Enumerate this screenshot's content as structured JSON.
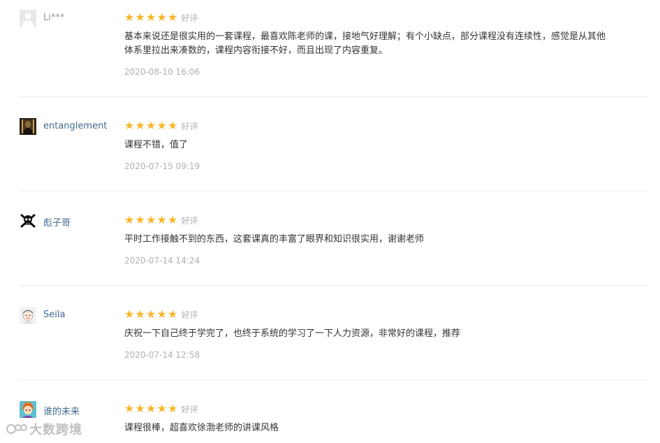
{
  "reviews": [
    {
      "username": "Li***",
      "avatar_icon": "default-user-icon",
      "rating": 5,
      "grade_label": "好评",
      "content_lines": [
        "基本来说还是很实用的一套课程，最喜欢陈老师的课，接地气好理解；有个小缺点，部分课程没有连续性，感觉是从其他",
        "体系里拉出来凑数的，课程内容衔接不好，而且出现了内容重复。"
      ],
      "time": "2020-08-10 16:06"
    },
    {
      "username": "entanglement",
      "avatar_icon": "dark-portrait-icon",
      "rating": 5,
      "grade_label": "好评",
      "content_lines": [
        "课程不错，值了"
      ],
      "time": "2020-07-15 09:19"
    },
    {
      "username": "彪子哥",
      "avatar_icon": "skull-crossbones-icon",
      "rating": 5,
      "grade_label": "好评",
      "content_lines": [
        "平时工作接触不到的东西，这套课真的丰富了眼界和知识很实用，谢谢老师"
      ],
      "time": "2020-07-14 14:24"
    },
    {
      "username": "Seila",
      "avatar_icon": "cartoon-face-icon",
      "rating": 5,
      "grade_label": "好评",
      "content_lines": [
        "庆祝一下自己终于学完了，也终于系统的学习了一下人力资源，非常好的课程，推荐"
      ],
      "time": "2020-07-14 12:58"
    },
    {
      "username": "谁的未来",
      "avatar_icon": "anime-character-icon",
      "rating": 5,
      "grade_label": "好评",
      "content_lines": [
        "课程很棒，超喜欢徐渤老师的讲课风格"
      ],
      "time": ""
    }
  ],
  "watermark": {
    "icon": "brand-logo-icon",
    "text": "大数跨境"
  },
  "colors": {
    "star": "#f8b627",
    "username": "#3f6a92",
    "muted": "#b0b0b0",
    "text": "#333333"
  }
}
